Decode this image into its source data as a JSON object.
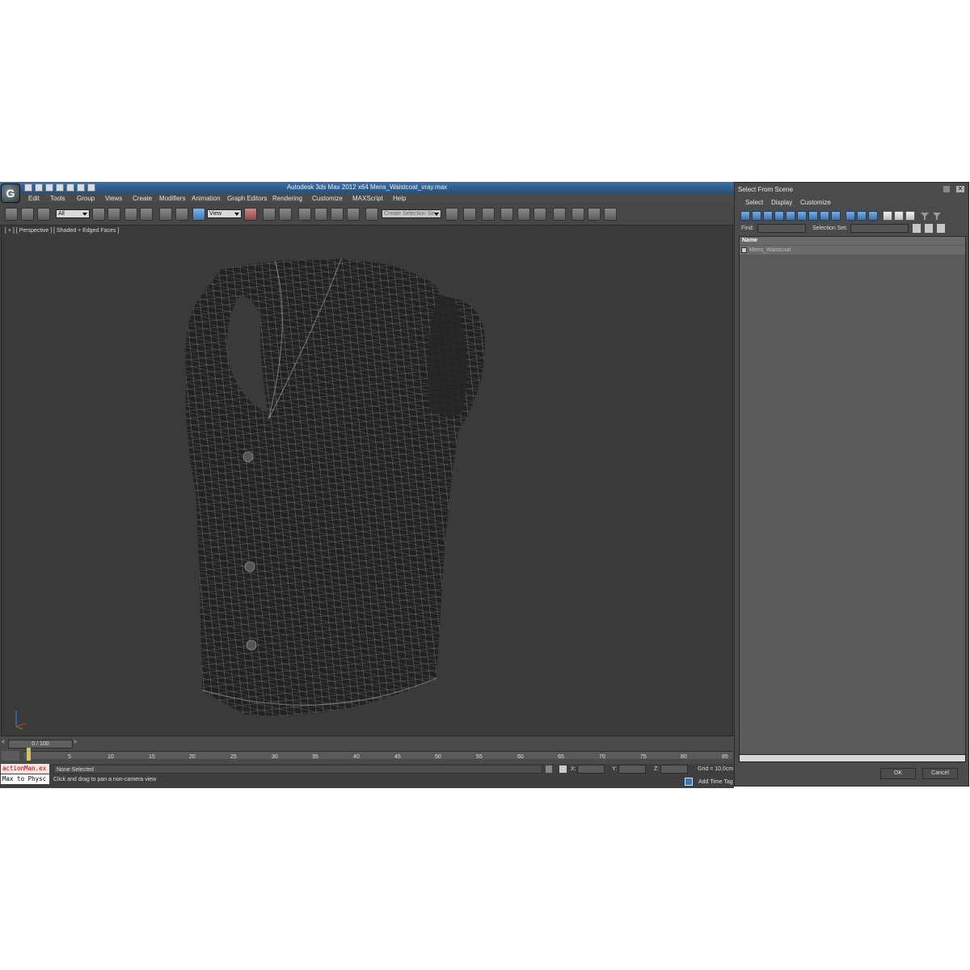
{
  "window": {
    "title": "Autodesk 3ds Max  2012 x64      Mens_Waistcoat_vray.max",
    "logo": "G"
  },
  "menu": [
    "Edit",
    "Tools",
    "Group",
    "Views",
    "Create",
    "Modifiers",
    "Animation",
    "Graph Editors",
    "Rendering",
    "Customize",
    "MAXScript",
    "Help"
  ],
  "toolbar": {
    "filter_value": "All",
    "ref_coord_value": "View",
    "selection_set_placeholder": "Create Selection Se"
  },
  "viewport": {
    "label": "[ + ] [ Perspective ] [ Shaded + Edged Faces ]"
  },
  "timeline": {
    "frame_counter": "0 / 100",
    "prev_arrow": "<",
    "next_arrow": ">",
    "ticks": [
      "5",
      "10",
      "15",
      "20",
      "25",
      "30",
      "35",
      "40",
      "45",
      "50",
      "55",
      "60",
      "65",
      "70",
      "75",
      "80",
      "85"
    ]
  },
  "status": {
    "script_line_1": "actionMan.ex",
    "script_line_2": "Max to Physc",
    "selection": "None Selected",
    "prompt": "Click and drag to pan a non-camera view",
    "x_label": "X:",
    "y_label": "Y:",
    "z_label": "Z:",
    "grid": "Grid = 10,0cm",
    "add_time_tag": "Add Time Tag"
  },
  "dialog": {
    "title": "Select From Scene",
    "menu": [
      "Select",
      "Display",
      "Customize"
    ],
    "find_label": "Find:",
    "selection_set_label": "Selection Set:",
    "column_name": "Name",
    "items": [
      "Mens_Waistcoat"
    ],
    "ok_label": "OK",
    "cancel_label": "Cancel"
  }
}
